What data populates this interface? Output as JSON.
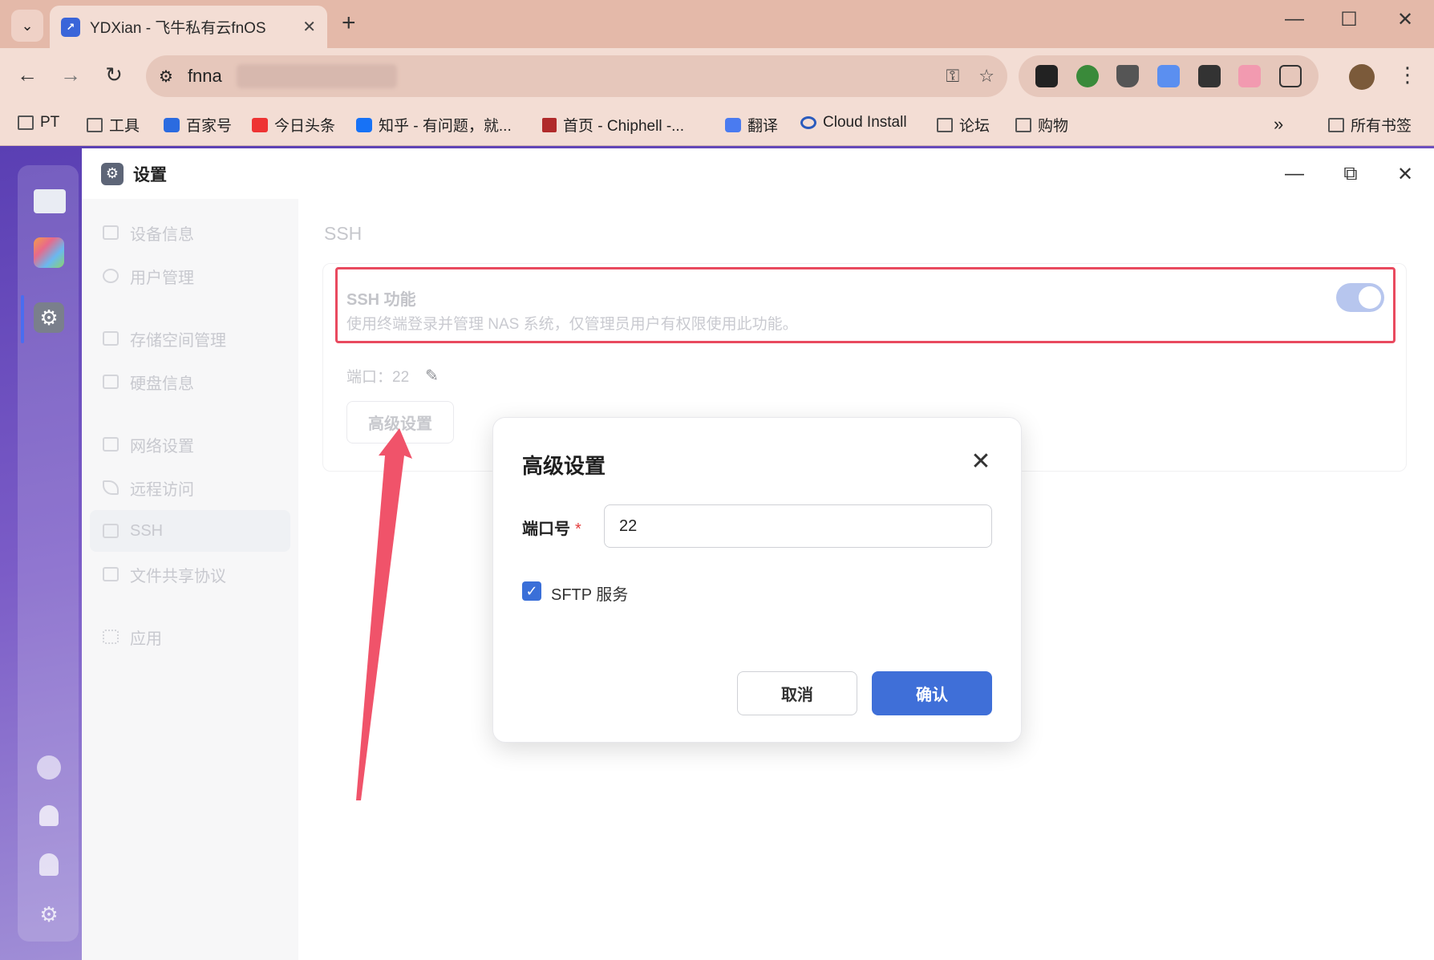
{
  "browser": {
    "tab_title": "YDXian - 飞牛私有云fnOS",
    "tab_favicon": "fnOS",
    "url": "fnna",
    "bookmarks": [
      "PT",
      "工具",
      "百家号",
      "今日头条",
      "知乎 - 有问题，就...",
      "首页 - Chiphell -...",
      "翻译",
      "Cloud Install",
      "论坛",
      "购物"
    ],
    "bookmarks_all": "所有书签",
    "more": "»"
  },
  "window": {
    "title": "设置"
  },
  "sidebar": {
    "items": [
      {
        "label": "设备信息"
      },
      {
        "label": "用户管理"
      },
      {
        "label": "存储空间管理"
      },
      {
        "label": "硬盘信息"
      },
      {
        "label": "网络设置"
      },
      {
        "label": "远程访问"
      },
      {
        "label": "SSH"
      },
      {
        "label": "文件共享协议"
      },
      {
        "label": "应用"
      }
    ]
  },
  "main": {
    "section_title": "SSH",
    "ssh_name": "SSH 功能",
    "ssh_desc": "使用终端登录并管理 NAS 系统，仅管理员用户有权限使用此功能。",
    "port_label": "端口：",
    "port_value": "22",
    "advanced_button": "高级设置",
    "ssh_enabled": true
  },
  "modal": {
    "title": "高级设置",
    "port_label": "端口号",
    "required_mark": "*",
    "port_value": "22",
    "sftp_label": "SFTP 服务",
    "sftp_checked": true,
    "cancel": "取消",
    "confirm": "确认"
  },
  "colors": {
    "accent": "#3f6fd8",
    "highlight_border": "#e94a5f",
    "arrow": "#f0536a"
  }
}
